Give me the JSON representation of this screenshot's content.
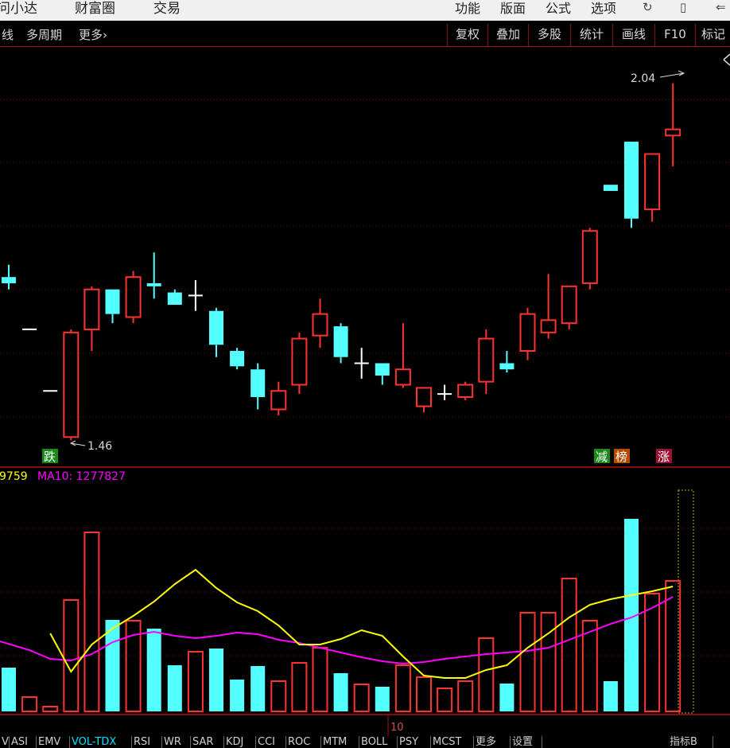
{
  "menubar": {
    "left": [
      "问小达",
      "财富圈",
      "交易"
    ],
    "right": [
      "功能",
      "版面",
      "公式",
      "选项"
    ]
  },
  "toolbar": {
    "left": [
      "线",
      "多周期",
      "更多"
    ],
    "buttons": [
      "复权",
      "叠加",
      "多股",
      "统计",
      "画线",
      "F10",
      "标记"
    ]
  },
  "price_panel": {
    "high_label": "2.04",
    "low_label": "1.46",
    "tags": [
      {
        "text": "跌",
        "color": "#1a8a1a"
      },
      {
        "text": "减",
        "color": "#1a8a1a"
      },
      {
        "text": "榜",
        "color": "#b84a00"
      },
      {
        "text": "涨",
        "color": "#a01030"
      }
    ]
  },
  "volume_panel": {
    "ma5_label": "9759",
    "ma10_label": "MA10: 1277827",
    "ma5_color": "#ffff00",
    "ma10_color": "#ff00ff",
    "x_label": "10"
  },
  "bottom_tabs": [
    "V",
    "ASI",
    "EMV",
    "VOL-TDX",
    "RSI",
    "WR",
    "SAR",
    "KDJ",
    "CCI",
    "ROC",
    "MTM",
    "BOLL",
    "PSY",
    "MCST",
    "更多",
    "设置"
  ],
  "active_tab": "VOL-TDX",
  "right_tab": "指标B",
  "colors": {
    "up": "#ff3232",
    "down": "#54ffff",
    "doji": "#ffffff",
    "grid": "#7a1010"
  },
  "chart_data": {
    "type": "candlestick",
    "candles": [
      {
        "o": 1.725,
        "h": 1.745,
        "l": 1.705,
        "c": 1.715
      },
      {
        "o": 1.64,
        "h": 1.64,
        "l": 1.64,
        "c": 1.64
      },
      {
        "o": 1.54,
        "h": 1.54,
        "l": 1.54,
        "c": 1.54
      },
      {
        "o": 1.465,
        "h": 1.64,
        "l": 1.46,
        "c": 1.635
      },
      {
        "o": 1.64,
        "h": 1.71,
        "l": 1.605,
        "c": 1.705
      },
      {
        "o": 1.705,
        "h": 1.705,
        "l": 1.65,
        "c": 1.665
      },
      {
        "o": 1.66,
        "h": 1.735,
        "l": 1.65,
        "c": 1.725
      },
      {
        "o": 1.715,
        "h": 1.765,
        "l": 1.69,
        "c": 1.71
      },
      {
        "o": 1.7,
        "h": 1.705,
        "l": 1.68,
        "c": 1.68
      },
      {
        "o": 1.695,
        "h": 1.72,
        "l": 1.67,
        "c": 1.695
      },
      {
        "o": 1.67,
        "h": 1.675,
        "l": 1.595,
        "c": 1.615
      },
      {
        "o": 1.605,
        "h": 1.61,
        "l": 1.575,
        "c": 1.58
      },
      {
        "o": 1.575,
        "h": 1.585,
        "l": 1.51,
        "c": 1.53
      },
      {
        "o": 1.51,
        "h": 1.555,
        "l": 1.5,
        "c": 1.54
      },
      {
        "o": 1.55,
        "h": 1.635,
        "l": 1.535,
        "c": 1.625
      },
      {
        "o": 1.63,
        "h": 1.69,
        "l": 1.61,
        "c": 1.665
      },
      {
        "o": 1.645,
        "h": 1.65,
        "l": 1.585,
        "c": 1.595
      },
      {
        "o": 1.585,
        "h": 1.61,
        "l": 1.56,
        "c": 1.585
      },
      {
        "o": 1.585,
        "h": 1.585,
        "l": 1.55,
        "c": 1.565
      },
      {
        "o": 1.55,
        "h": 1.65,
        "l": 1.545,
        "c": 1.575
      },
      {
        "o": 1.515,
        "h": 1.545,
        "l": 1.505,
        "c": 1.545
      },
      {
        "o": 1.535,
        "h": 1.55,
        "l": 1.525,
        "c": 1.535
      },
      {
        "o": 1.53,
        "h": 1.555,
        "l": 1.525,
        "c": 1.55
      },
      {
        "o": 1.555,
        "h": 1.64,
        "l": 1.535,
        "c": 1.625
      },
      {
        "o": 1.585,
        "h": 1.605,
        "l": 1.57,
        "c": 1.575
      },
      {
        "o": 1.605,
        "h": 1.675,
        "l": 1.59,
        "c": 1.665
      },
      {
        "o": 1.635,
        "h": 1.73,
        "l": 1.625,
        "c": 1.655
      },
      {
        "o": 1.65,
        "h": 1.71,
        "l": 1.64,
        "c": 1.71
      },
      {
        "o": 1.715,
        "h": 1.805,
        "l": 1.705,
        "c": 1.8
      },
      {
        "o": 1.875,
        "h": 1.875,
        "l": 1.865,
        "c": 1.865
      },
      {
        "o": 1.945,
        "h": 1.945,
        "l": 1.805,
        "c": 1.82
      },
      {
        "o": 1.835,
        "h": 1.925,
        "l": 1.815,
        "c": 1.925
      },
      {
        "o": 1.955,
        "h": 2.04,
        "l": 1.905,
        "c": 1.965
      }
    ],
    "volume": [
      55,
      18,
      6,
      140,
      225,
      115,
      114,
      104,
      58,
      75,
      79,
      40,
      57,
      38,
      61,
      80,
      48,
      34,
      31,
      58,
      43,
      29,
      38,
      92,
      35,
      124,
      124,
      167,
      114,
      38,
      242,
      148,
      164
    ],
    "ma5": [
      null,
      null,
      98,
      50,
      84,
      104,
      120,
      138,
      160,
      178,
      155,
      137,
      126,
      108,
      84,
      84,
      91,
      102,
      95,
      69,
      45,
      42,
      42,
      52,
      58,
      80,
      98,
      118,
      134,
      141,
      146,
      151,
      157
    ],
    "ma10": [
      88,
      77,
      66,
      64,
      72,
      87,
      96,
      100,
      95,
      92,
      95,
      99,
      97,
      90,
      86,
      80,
      74,
      68,
      63,
      60,
      62,
      66,
      69,
      72,
      74,
      76,
      80,
      90,
      100,
      110,
      118,
      130,
      144
    ],
    "price_range": [
      1.455,
      2.055
    ],
    "volume_range": [
      0,
      290
    ]
  }
}
